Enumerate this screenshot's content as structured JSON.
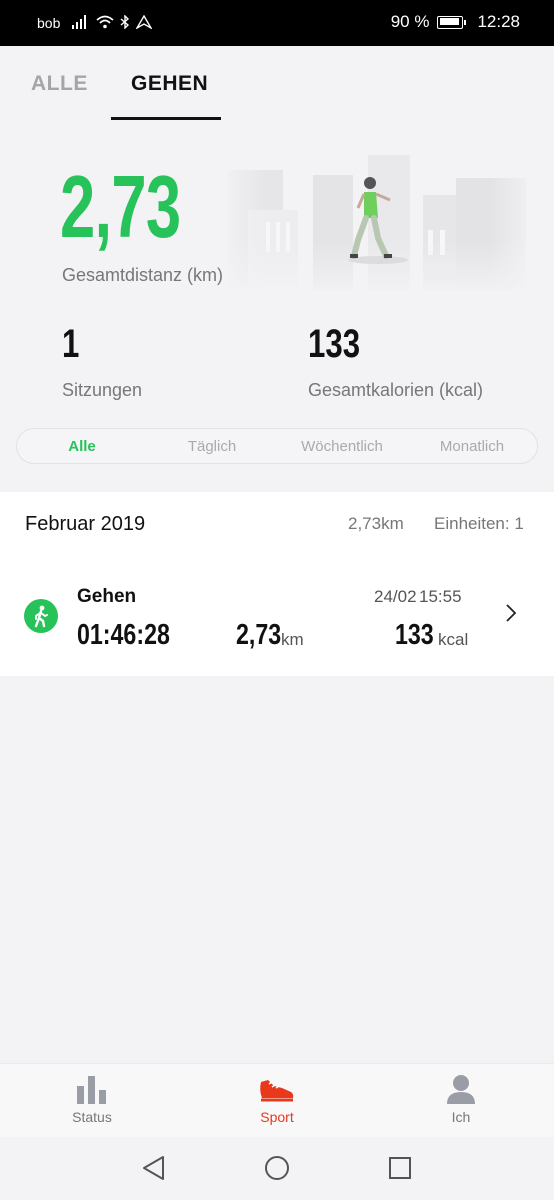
{
  "status_bar": {
    "carrier": "bob",
    "battery": "90 %",
    "time": "12:28"
  },
  "top_tabs": [
    {
      "label": "ALLE",
      "active": false
    },
    {
      "label": "GEHEN",
      "active": true
    }
  ],
  "summary": {
    "distance_value": "2,73",
    "distance_label": "Gesamtdistanz (km)",
    "sessions_value": "1",
    "sessions_label": "Sitzungen",
    "calories_value": "133",
    "calories_label": "Gesamtkalorien (kcal)"
  },
  "filter": {
    "options": [
      "Alle",
      "Täglich",
      "Wöchentlich",
      "Monatlich"
    ],
    "selected": "Alle"
  },
  "month_group": {
    "title": "Februar 2019",
    "distance": "2,73km",
    "units": "Einheiten: 1"
  },
  "activity": {
    "icon": "walking-person-icon",
    "name": "Gehen",
    "date": "24/02",
    "time": "15:55",
    "duration": "01:46:28",
    "distance": "2,73",
    "distance_unit": "km",
    "calories": "133",
    "calories_unit": "kcal"
  },
  "bottom_nav": [
    {
      "label": "Status",
      "icon": "bar-chart-icon",
      "active": false
    },
    {
      "label": "Sport",
      "icon": "sneaker-icon",
      "active": true
    },
    {
      "label": "Ich",
      "icon": "person-icon",
      "active": false
    }
  ],
  "colors": {
    "accent_green": "#27c35a",
    "accent_red": "#e8391c",
    "text_dark": "#111111",
    "text_muted": "#777777"
  }
}
